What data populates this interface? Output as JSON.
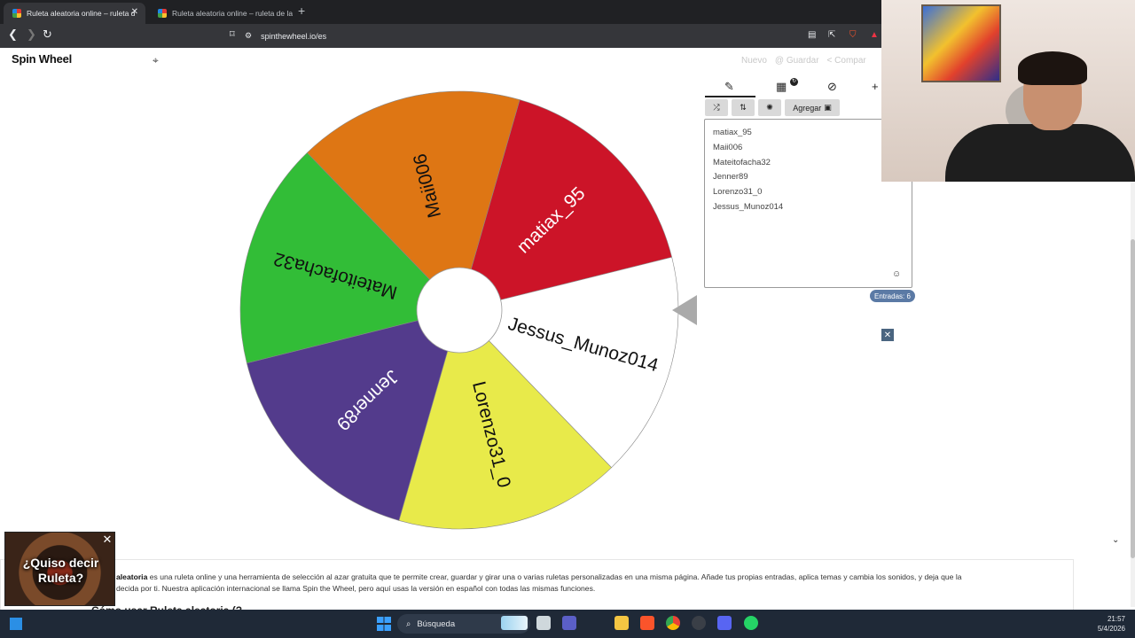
{
  "browser": {
    "tabs": [
      {
        "title": "Ruleta aleatoria online – ruleta d",
        "active": true
      },
      {
        "title": "Ruleta aleatoria online – ruleta de la",
        "active": false
      }
    ],
    "url": "spinthewheel.io/es"
  },
  "header": {
    "logo": "Spin Wheel",
    "actions": [
      "Nuevo",
      "Guardar",
      "Compar"
    ]
  },
  "wheel": {
    "segments": [
      {
        "label": "matiax_95",
        "color": "#cc1428",
        "text_color": "#ffffff"
      },
      {
        "label": "Jessus_Munoz014",
        "color": "#ffffff",
        "text_color": "#111111"
      },
      {
        "label": "Lorenzo31_0",
        "color": "#e8ea4a",
        "text_color": "#111111"
      },
      {
        "label": "Jenner89",
        "color": "#533b8c",
        "text_color": "#ffffff"
      },
      {
        "label": "Mateitofacha32",
        "color": "#32bd37",
        "text_color": "#111111"
      },
      {
        "label": "Maii006",
        "color": "#de7614",
        "text_color": "#111111"
      }
    ]
  },
  "panel": {
    "add_button": "Agregar",
    "entries": [
      "matiax_95",
      "Maii006",
      "Mateitofacha32",
      "Jenner89",
      "Lorenzo31_0",
      "Jessus_Munoz014"
    ],
    "count_label": "Entradas: 6",
    "icons": [
      "pencil-icon",
      "clipboard-icon",
      "eye-off-icon",
      "plus-icon",
      "shuffle-icon",
      "sort-icon",
      "settings-icon",
      "image-icon",
      "emoji-icon"
    ]
  },
  "description": {
    "bold_prefix": "aleatoria",
    "text": " es una ruleta online y una herramienta de selección al azar gratuita que te permite crear, guardar y girar una o varias ruletas personalizadas en una misma página. Añade tus propias entradas, aplica temas y cambia los sonidos, y deja que la",
    "text2": "decida por ti. Nuestra aplicación internacional se llama Spin the Wheel, pero aquí usas la versión en español con todas las mismas funciones.",
    "heading": "Cómo usar Ruleta aleatoria (?"
  },
  "ad": {
    "text": "¿Quiso decir Ruleta?"
  },
  "taskbar": {
    "search": "Búsqueda",
    "time": "21:57",
    "date": "5/4/2026"
  }
}
